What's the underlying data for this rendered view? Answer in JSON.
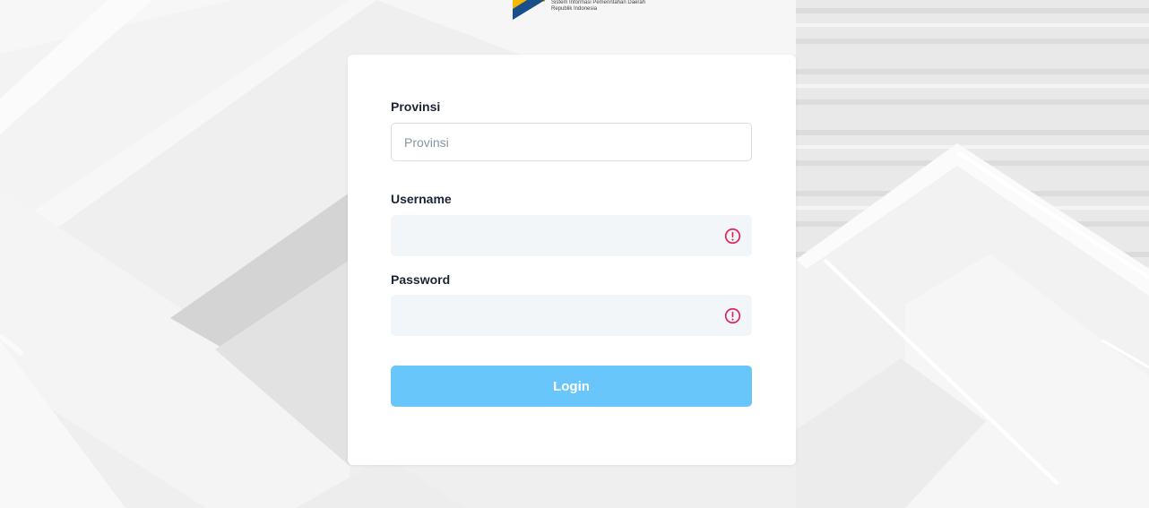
{
  "logo": {
    "line1": "Sistem Informasi Pemerintahan Daerah",
    "line2": "Republik Indonesia",
    "colors": {
      "navy": "#1b4f8a",
      "gold": "#f5b800"
    }
  },
  "form": {
    "provinsi": {
      "label": "Provinsi",
      "placeholder": "Provinsi",
      "value": ""
    },
    "username": {
      "label": "Username",
      "value": "",
      "status_icon": "alert-circle-icon"
    },
    "password": {
      "label": "Password",
      "value": "",
      "status_icon": "alert-circle-icon"
    },
    "submit_label": "Login"
  },
  "colors": {
    "button": "#69c6fa",
    "error": "#e0245e",
    "label_text": "#1c2434",
    "input_fill": "#f3f6f9"
  }
}
